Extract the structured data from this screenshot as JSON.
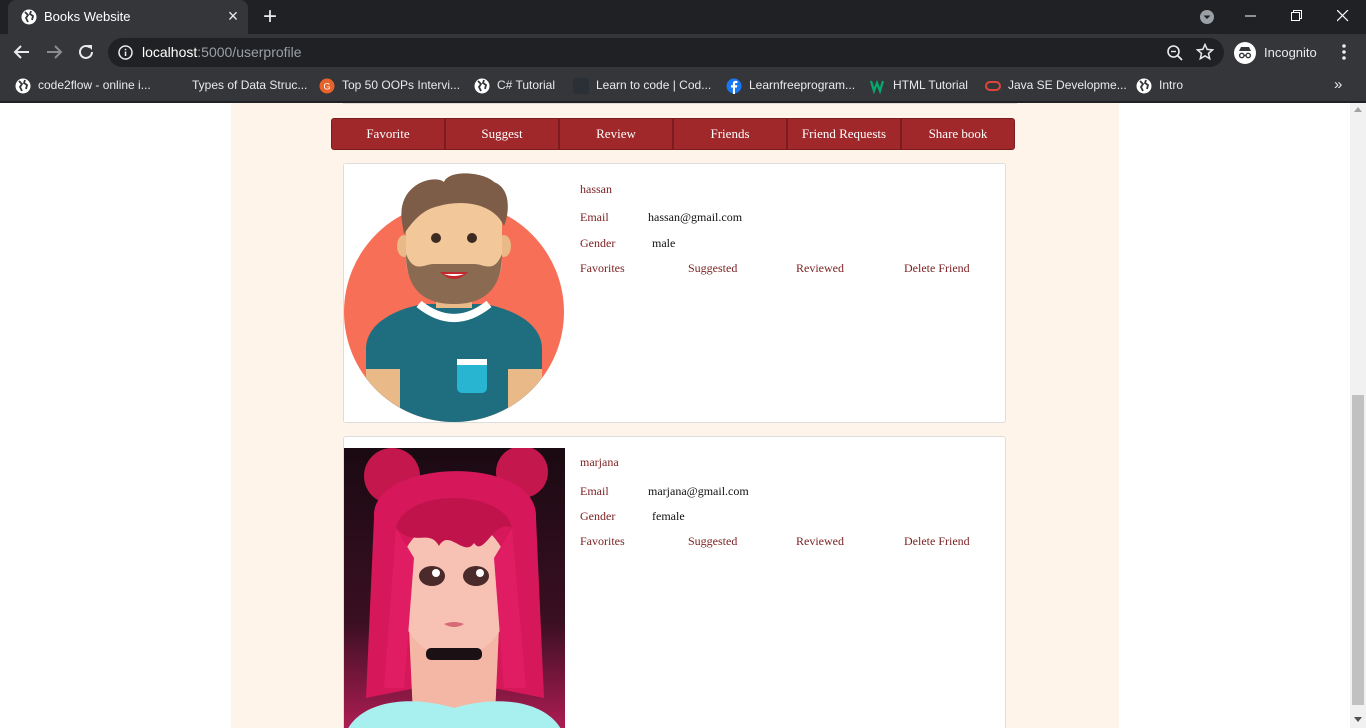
{
  "browser": {
    "tab_title": "Books Website",
    "url_host": "localhost",
    "url_path": ":5000/userprofile",
    "incognito_label": "Incognito",
    "bookmarks": [
      {
        "label": "code2flow - online i...",
        "icon": "globe-icon"
      },
      {
        "label": "Types of Data Struc...",
        "icon": "bookmark-blank-icon"
      },
      {
        "label": "Top 50 OOPs Intervi...",
        "icon": "g-orange-icon"
      },
      {
        "label": "C# Tutorial",
        "icon": "globe-icon"
      },
      {
        "label": "Learn to code | Cod...",
        "icon": "dark-square-icon"
      },
      {
        "label": "Learnfreeprogram...",
        "icon": "facebook-icon"
      },
      {
        "label": "HTML Tutorial",
        "icon": "w3schools-icon"
      },
      {
        "label": "Java SE Developme...",
        "icon": "oracle-icon"
      },
      {
        "label": "Intro",
        "icon": "globe-icon"
      }
    ]
  },
  "nav": {
    "items": [
      "Favorite",
      "Suggest",
      "Review",
      "Friends",
      "Friend Requests",
      "Share book"
    ]
  },
  "friends": [
    {
      "name": "hassan",
      "email_label": "Email",
      "email": "hassan@gmail.com",
      "gender_label": "Gender",
      "gender": "male",
      "links": [
        "Favorites",
        "Suggested",
        "Reviewed",
        "Delete Friend"
      ]
    },
    {
      "name": "marjana",
      "email_label": "Email",
      "email": "marjana@gmail.com",
      "gender_label": "Gender",
      "gender": "female",
      "links": [
        "Favorites",
        "Suggested",
        "Reviewed",
        "Delete Friend"
      ]
    }
  ],
  "colors": {
    "accent": "#a0282a",
    "page_background": "#fff4ea",
    "label_text": "#7a1f20"
  }
}
